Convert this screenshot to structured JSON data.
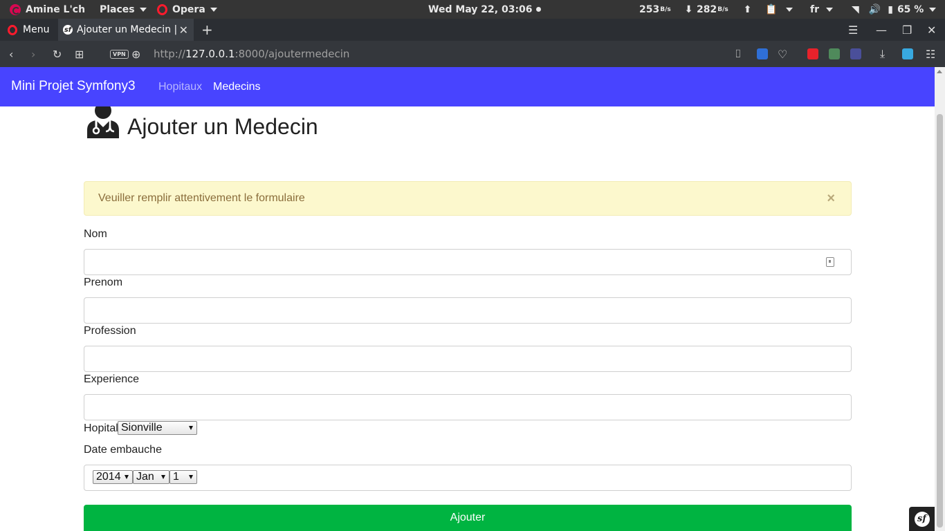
{
  "system_bar": {
    "user_name": "Amine L'ch",
    "places_label": "Places",
    "app_label": "Opera",
    "datetime": "Wed May 22, 03:06",
    "net_down_value": "253",
    "net_down_unit": "B/s",
    "net_up_value": "282",
    "net_up_unit": "B/s",
    "keyboard_layout": "fr",
    "battery": "65 %"
  },
  "browser": {
    "menu_label": "Menu",
    "tab_title": "Ajouter un Medecin |",
    "new_tab_label": "+",
    "vpn_label": "VPN",
    "url_scheme": "http://",
    "url_host": "127.0.0.1",
    "url_rest": ":8000/ajoutermedecin",
    "colors": {
      "opera_red": "#ff1b2d",
      "tab_bg": "#3b3f45"
    }
  },
  "navbar": {
    "brand": "Mini Projet Symfony3",
    "links": [
      {
        "label": "Hopitaux",
        "active": false
      },
      {
        "label": "Medecins",
        "active": true
      }
    ],
    "color": "#4844ff"
  },
  "page": {
    "title": "Ajouter un Medecin",
    "title_icon": "doctor-icon",
    "alert_message": "Veuiller remplir attentivement le formulaire",
    "form": {
      "nom_label": "Nom",
      "nom_value": "",
      "prenom_label": "Prenom",
      "prenom_value": "",
      "profession_label": "Profession",
      "profession_value": "",
      "experience_label": "Experience",
      "experience_value": "",
      "hopital_label": "Hopital",
      "hopital_selected": "Sionville",
      "date_label": "Date embauche",
      "date_year": "2014",
      "date_month": "Jan",
      "date_day": "1",
      "submit_label": "Ajouter"
    },
    "submit_color": "#00b441",
    "alert_color": "#fcf8cd"
  }
}
